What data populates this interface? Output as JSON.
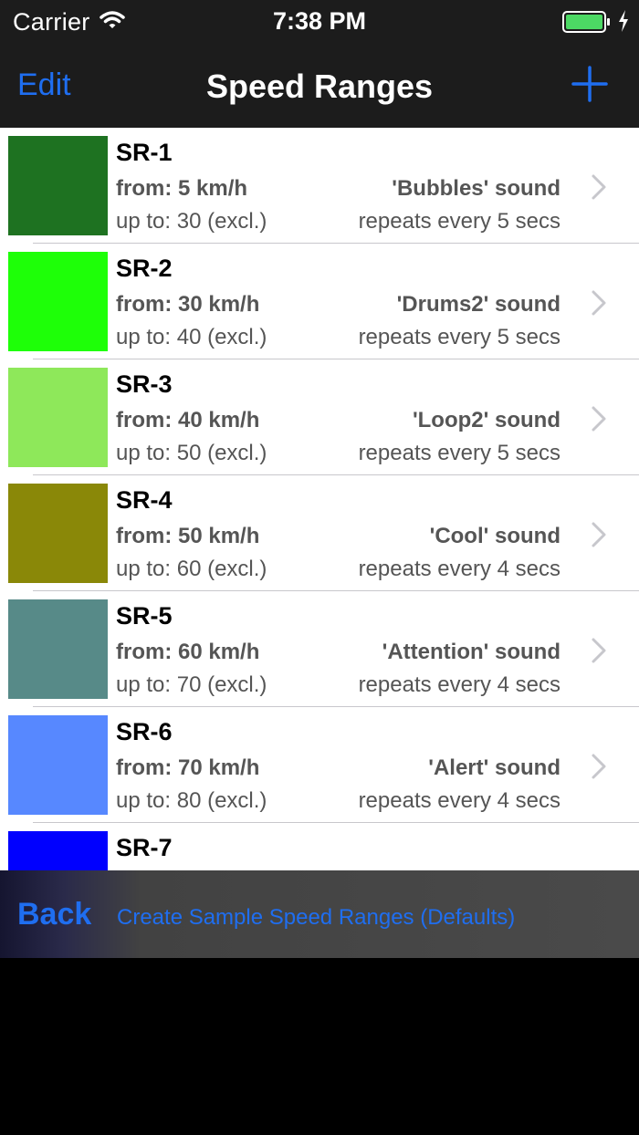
{
  "status_bar": {
    "carrier": "Carrier",
    "time": "7:38 PM"
  },
  "nav": {
    "edit_label": "Edit",
    "title": "Speed Ranges",
    "add_icon": "plus-icon"
  },
  "speed_ranges": [
    {
      "name": "SR-1",
      "from": "from: 5 km/h",
      "up_to": "up to: 30 (excl.)",
      "sound": "'Bubbles' sound",
      "repeat": "repeats every 5 secs",
      "color": "#1e7221"
    },
    {
      "name": "SR-2",
      "from": "from: 30 km/h",
      "up_to": "up to: 40 (excl.)",
      "sound": "'Drums2' sound",
      "repeat": "repeats every 5 secs",
      "color": "#1eff08"
    },
    {
      "name": "SR-3",
      "from": "from: 40 km/h",
      "up_to": "up to: 50 (excl.)",
      "sound": "'Loop2' sound",
      "repeat": "repeats every 5 secs",
      "color": "#8ee85a"
    },
    {
      "name": "SR-4",
      "from": "from: 50 km/h",
      "up_to": "up to: 60 (excl.)",
      "sound": "'Cool' sound",
      "repeat": "repeats every 4 secs",
      "color": "#8a8808"
    },
    {
      "name": "SR-5",
      "from": "from: 60 km/h",
      "up_to": "up to: 70 (excl.)",
      "sound": "'Attention' sound",
      "repeat": "repeats every 4 secs",
      "color": "#578a88"
    },
    {
      "name": "SR-6",
      "from": "from: 70 km/h",
      "up_to": "up to: 80 (excl.)",
      "sound": "'Alert' sound",
      "repeat": "repeats every 4 secs",
      "color": "#5788ff"
    },
    {
      "name": "SR-7",
      "color": "#0000ff"
    }
  ],
  "toolbar": {
    "back_label": "Back",
    "defaults_label": "Create Sample Speed Ranges (Defaults)"
  },
  "colors": {
    "accent": "#1f6ef0",
    "bar_background": "#1c1c1c"
  }
}
